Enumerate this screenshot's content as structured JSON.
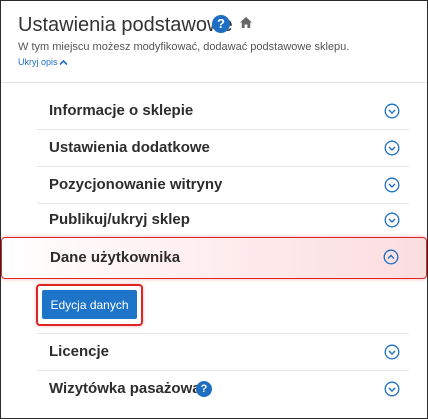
{
  "header": {
    "title": "Ustawienia podstawowe",
    "help_icon_text": "?",
    "description": "W tym miejscu możesz modyfikować, dodawać podstawowe sklepu.",
    "toggle_label": "Ukryj opis"
  },
  "sections": [
    {
      "label": "Informacje o sklepie",
      "expanded": false
    },
    {
      "label": "Ustawienia dodatkowe",
      "expanded": false
    },
    {
      "label": "Pozycjonowanie witryny",
      "expanded": false
    },
    {
      "label": "Publikuj/ukryj sklep",
      "expanded": false
    },
    {
      "label": "Dane użytkownika",
      "expanded": true,
      "button_label": "Edycja danych"
    },
    {
      "label": "Licencje",
      "expanded": false
    },
    {
      "label": "Wizytówka pasażowa",
      "expanded": false,
      "help_icon_text": "?"
    }
  ],
  "colors": {
    "accent": "#1e74c9",
    "highlight_border": "#e02424"
  }
}
